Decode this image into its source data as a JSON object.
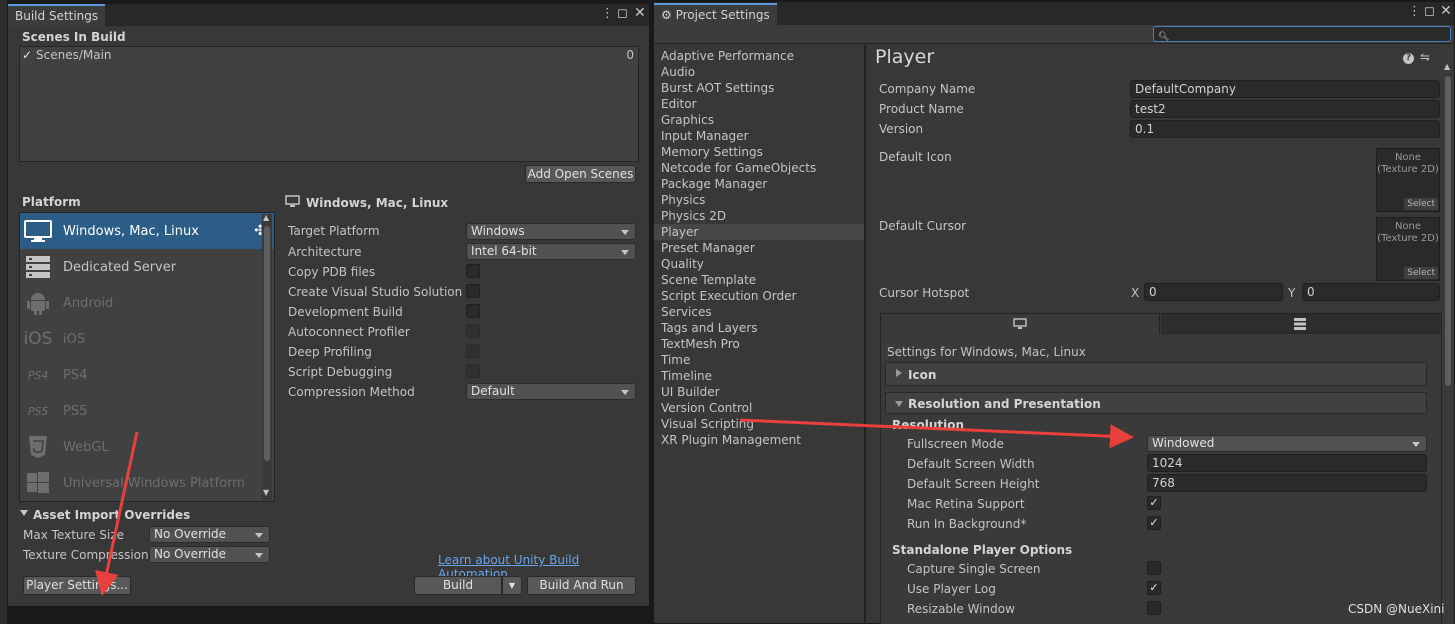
{
  "build_settings": {
    "tab_title": "Build Settings",
    "scenes_header": "Scenes In Build",
    "scene": {
      "name": "Scenes/Main",
      "index": "0",
      "checked": true
    },
    "add_open_scenes": "Add Open Scenes",
    "platform_header": "Platform",
    "platforms": [
      {
        "label": "Windows, Mac, Linux",
        "icon": "monitor-icon",
        "selected": true
      },
      {
        "label": "Dedicated Server",
        "icon": "server-icon"
      },
      {
        "label": "Android",
        "icon": "android-icon"
      },
      {
        "label": "iOS",
        "icon": "ios-icon",
        "icon_text": "iOS"
      },
      {
        "label": "PS4",
        "icon": "ps4-icon",
        "icon_text": "PS4"
      },
      {
        "label": "PS5",
        "icon": "ps5-icon",
        "icon_text": "PS5"
      },
      {
        "label": "WebGL",
        "icon": "html5-icon"
      },
      {
        "label": "Universal Windows Platform",
        "icon": "windows-logo-icon"
      }
    ],
    "right_title": "Windows, Mac, Linux",
    "settings": [
      {
        "label": "Target Platform",
        "type": "dropdown",
        "value": "Windows"
      },
      {
        "label": "Architecture",
        "type": "dropdown",
        "value": "Intel 64-bit"
      },
      {
        "label": "Copy PDB files",
        "type": "checkbox",
        "checked": false
      },
      {
        "label": "Create Visual Studio Solution",
        "type": "checkbox",
        "checked": false
      },
      {
        "label": "Development Build",
        "type": "checkbox",
        "checked": false
      },
      {
        "label": "Autoconnect Profiler",
        "type": "checkbox",
        "checked": false,
        "disabled": true
      },
      {
        "label": "Deep Profiling",
        "type": "checkbox",
        "checked": false,
        "disabled": true
      },
      {
        "label": "Script Debugging",
        "type": "checkbox",
        "checked": false,
        "disabled": true
      },
      {
        "label": "Compression Method",
        "type": "dropdown",
        "value": "Default"
      }
    ],
    "asset_import_header": "Asset Import Overrides",
    "max_texture_size": {
      "label": "Max Texture Size",
      "value": "No Override"
    },
    "texture_compression": {
      "label": "Texture Compression",
      "value": "No Override"
    },
    "learn_link": "Learn about Unity Build Automation",
    "player_settings_button": "Player Settings...",
    "build_button": "Build",
    "build_and_run_button": "Build And Run"
  },
  "project_settings": {
    "tab_title": "Project Settings",
    "search_placeholder": "",
    "categories": [
      "Adaptive Performance",
      "Audio",
      "Burst AOT Settings",
      "Editor",
      "Graphics",
      "Input Manager",
      "Memory Settings",
      "Netcode for GameObjects",
      "Package Manager",
      "Physics",
      "Physics 2D",
      "Player",
      "Preset Manager",
      "Quality",
      "Scene Template",
      "Script Execution Order",
      "Services",
      "Tags and Layers",
      "TextMesh Pro",
      "Time",
      "Timeline",
      "UI Builder",
      "Version Control",
      "Visual Scripting",
      "XR Plugin Management"
    ],
    "selected_category": "Player",
    "page_title": "Player",
    "company_name": {
      "label": "Company Name",
      "value": "DefaultCompany"
    },
    "product_name": {
      "label": "Product Name",
      "value": "test2"
    },
    "version": {
      "label": "Version",
      "value": "0.1"
    },
    "default_icon": {
      "label": "Default Icon",
      "none": "None",
      "type": "(Texture 2D)",
      "select": "Select"
    },
    "default_cursor": {
      "label": "Default Cursor",
      "none": "None",
      "type": "(Texture 2D)",
      "select": "Select"
    },
    "cursor_hotspot": {
      "label": "Cursor Hotspot",
      "x_label": "X",
      "x_value": "0",
      "y_label": "Y",
      "y_value": "0"
    },
    "settings_for": "Settings for Windows, Mac, Linux",
    "icon_foldout": "Icon",
    "resolution_foldout": "Resolution and Presentation",
    "resolution_header": "Resolution",
    "fullscreen_mode": {
      "label": "Fullscreen Mode",
      "value": "Windowed"
    },
    "screen_width": {
      "label": "Default Screen Width",
      "value": "1024"
    },
    "screen_height": {
      "label": "Default Screen Height",
      "value": "768"
    },
    "mac_retina": {
      "label": "Mac Retina Support",
      "checked": true
    },
    "run_in_background": {
      "label": "Run In Background*",
      "checked": true
    },
    "standalone_header": "Standalone Player Options",
    "capture_single_screen": {
      "label": "Capture Single Screen",
      "checked": false
    },
    "use_player_log": {
      "label": "Use Player Log",
      "checked": true
    },
    "resizable_window": {
      "label": "Resizable Window",
      "checked": false
    }
  },
  "watermark": "CSDN @NueXini",
  "colors": {
    "arrow": "#e8403c",
    "selection": "#2c5d87",
    "accent_tab": "#5a9adb"
  }
}
